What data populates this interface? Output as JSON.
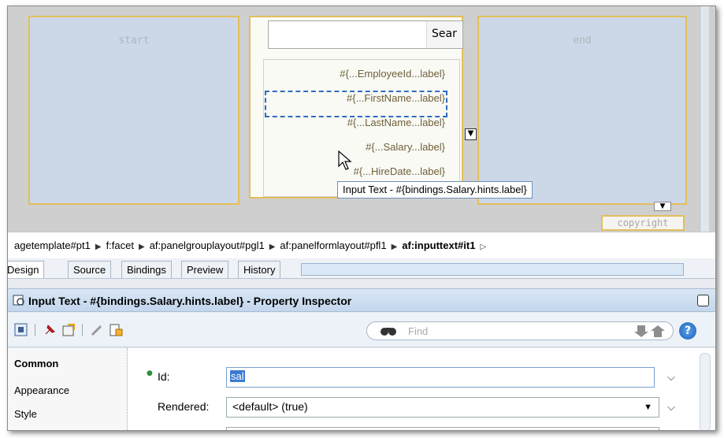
{
  "canvas": {
    "start_label": "start",
    "end_label": "end",
    "search_button": "Sear",
    "form_labels": [
      "#{...EmployeeId...label}",
      "#{...FirstName...label}",
      "#{...LastName...label}",
      "#{...Salary...label}",
      "#{...HireDate...label}"
    ],
    "tooltip": "Input Text - #{bindings.Salary.hints.label}",
    "copyright": "copyright"
  },
  "breadcrumb": {
    "items": [
      "agetemplate#pt1",
      "f:facet",
      "af:panelgrouplayout#pgl1",
      "af:panelformlayout#pfl1",
      "af:inputtext#it1"
    ]
  },
  "tabs": [
    "Design",
    "Source",
    "Bindings",
    "Preview",
    "History"
  ],
  "inspector": {
    "title": "Input Text - #{bindings.Salary.hints.label} - Property Inspector",
    "find_placeholder": "Find",
    "help": "?"
  },
  "categories": [
    "Common",
    "Appearance",
    "Style"
  ],
  "properties": {
    "id_label": "Id:",
    "id_value": "sal",
    "rendered_label": "Rendered:",
    "rendered_value": "<default> (true)"
  },
  "colors": {
    "pane_bg": "#ccd8e8",
    "pane_border": "#e3bf5a",
    "selection": "#2d6cc4",
    "id_highlight": "#3d7bd1"
  }
}
